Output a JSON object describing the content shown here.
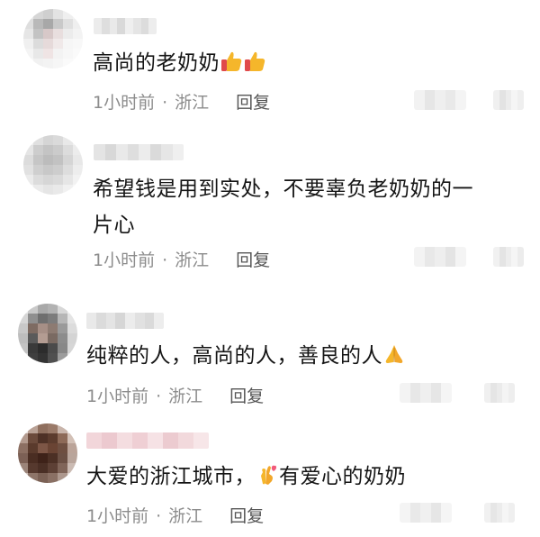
{
  "comments": [
    {
      "text": "高尚的老奶奶",
      "emoji": [
        "thumbs-up",
        "thumbs-up"
      ],
      "time": "1小时前",
      "separator": "·",
      "location": "浙江",
      "reply": "回复"
    },
    {
      "text_line1": "希望钱是用到实处，不要辜负老奶奶的一",
      "text_line2": "片心",
      "time": "1小时前",
      "separator": "·",
      "location": "浙江",
      "reply": "回复"
    },
    {
      "text": "纯粹的人，高尚的人，善良的人",
      "emoji": [
        "folded-hands"
      ],
      "time": "1小时前",
      "separator": "·",
      "location": "浙江",
      "reply": "回复"
    },
    {
      "text_before": "大爱的浙江城市，",
      "emoji": [
        "crossed-fingers-heart"
      ],
      "text_after": "有爱心的奶奶",
      "time": "1小时前",
      "separator": "·",
      "location": "浙江",
      "reply": "回复"
    }
  ],
  "colors": {
    "text": "#151515",
    "meta": "#8c8c8c",
    "emoji_yellow": "#f5b62b"
  }
}
